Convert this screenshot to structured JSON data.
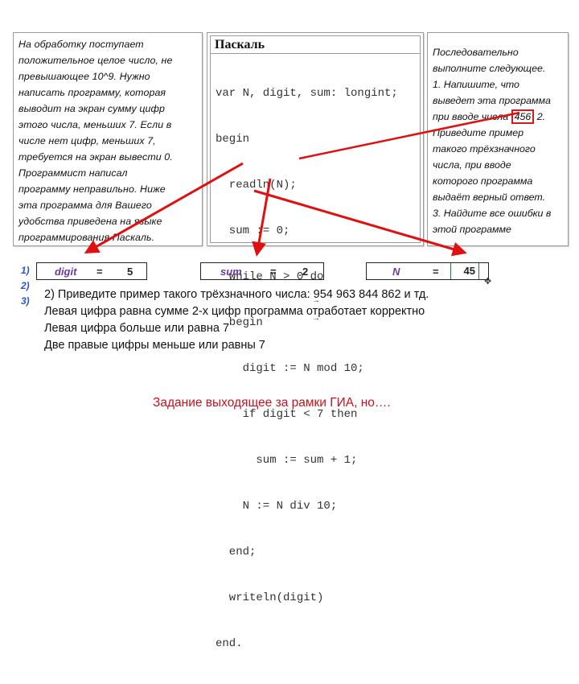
{
  "task_panel": {
    "lines": [
      "На обработку поступает",
      "положительное целое число, не",
      "превышающее 10^9. Нужно",
      "написать программу, которая",
      "выводит на экран сумму цифр",
      "этого числа, меньших 7. Если в",
      "числе нет цифр, меньших 7,",
      "требуется на экран вывести 0.",
      "Программист написал",
      "программу неправильно. Ниже",
      "эта программа для Вашего",
      "удобства приведена на языке",
      "программирования Паскаль."
    ]
  },
  "code_panel": {
    "header": "Паскаль",
    "lines": [
      "var N, digit, sum: longint;",
      "begin",
      "  readln(N);",
      "  sum := 0;",
      "  while N > 0 do",
      "  begin",
      "    digit := N mod 10;",
      "    if digit < 7 then",
      "      sum := sum + 1;",
      "    N := N div 10;",
      "  end;",
      "  writeln(digit)",
      "end."
    ]
  },
  "question_panel": {
    "lines_before": [
      "Последовательно",
      "выполните следующее.",
      "1. Напишите, что",
      "выведет эта программа"
    ],
    "line5_prefix": "при вводе числа ",
    "highlight_number": "456",
    "line5_suffix": " 2.",
    "lines_after": [
      "Приведите пример",
      "такого трёхзначного",
      "числа, при вводе",
      "которого программа",
      "выдаёт верный ответ.",
      "3. Найдите все ошибки в",
      "этой программе"
    ]
  },
  "step_numbers": [
    "1)",
    "2)",
    "3)"
  ],
  "variables": [
    {
      "name": "digit",
      "eq": "=",
      "value": "5"
    },
    {
      "name": "sum",
      "eq": "=",
      "value": "2"
    },
    {
      "name": "N",
      "eq": "=",
      "value": "45"
    }
  ],
  "answer": {
    "lines": [
      "2) Приведите пример такого трёхзначного числа: 954 963 844 862 и тд.",
      "Левая цифра равна  сумме 2-х цифр программа отработает корректно",
      "Левая цифра больше или равна 7",
      "Две правые цифры  меньше или равны 7"
    ]
  },
  "footer": "Задание выходящее за рамки ГИА, но….",
  "colors": {
    "arrow": "#e01010",
    "highlight_box": "#d41a1a",
    "footer_text": "#c8101e",
    "variable_name": "#6a3aa0",
    "step_numbers": "#2a55c8"
  }
}
